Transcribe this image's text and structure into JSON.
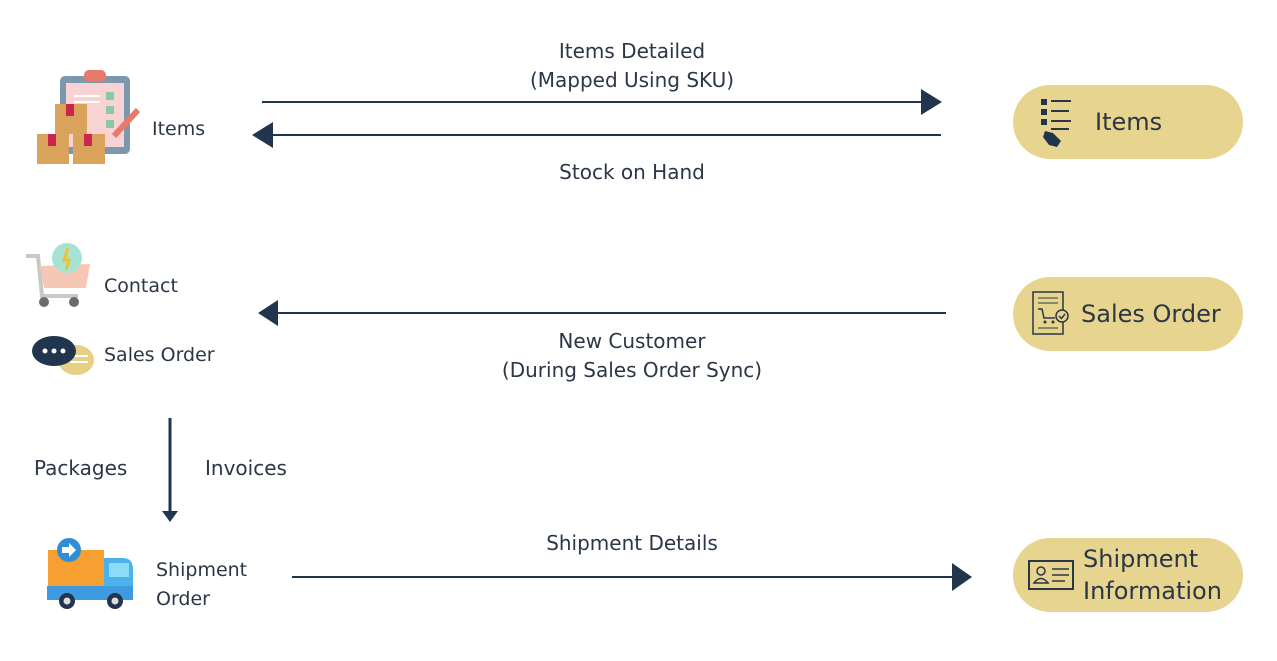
{
  "left_nodes": {
    "items": "Items",
    "contact": "Contact",
    "sales_order": "Sales Order",
    "shipment_order": [
      "Shipment",
      "Order"
    ]
  },
  "right_nodes": {
    "items": "Items",
    "sales_order": "Sales Order",
    "shipment_information": [
      "Shipment",
      "Information"
    ]
  },
  "edges": {
    "items_detailed": [
      "Items Detailed",
      "(Mapped Using SKU)"
    ],
    "stock_on_hand": "Stock on Hand",
    "new_customer": [
      "New Customer",
      "(During Sales Order Sync)"
    ],
    "packages": "Packages",
    "invoices": "Invoices",
    "shipment_details": "Shipment Details"
  },
  "colors": {
    "arrow": "#22354f",
    "pill": "#e7d58f",
    "text": "#2b3646"
  },
  "icons": [
    "clipboard-boxes-icon",
    "shopping-cart-icon",
    "chat-bubbles-icon",
    "delivery-truck-icon",
    "checklist-hand-icon",
    "invoice-cart-icon",
    "id-card-icon"
  ]
}
